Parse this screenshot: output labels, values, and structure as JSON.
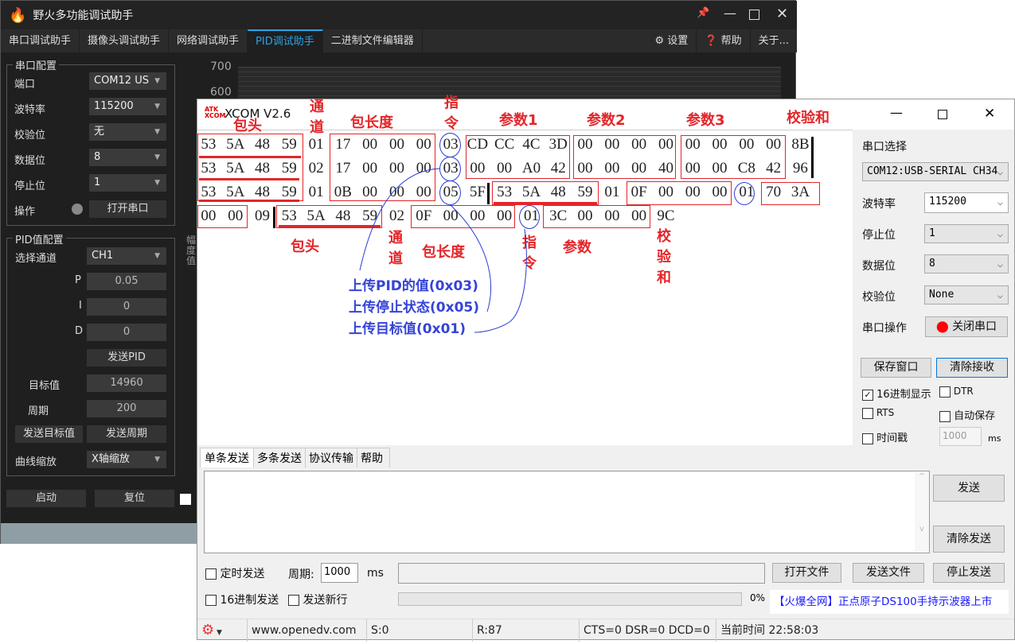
{
  "fire": {
    "title": "野火多功能调试助手",
    "tabs": [
      "串口调试助手",
      "摄像头调试助手",
      "网络调试助手",
      "PID调试助手",
      "二进制文件编辑器"
    ],
    "active_tab": "PID调试助手",
    "right_menu": {
      "settings": "设置",
      "help": "帮助",
      "about": "关于..."
    },
    "serial_group": "串口配置",
    "serial": [
      {
        "label": "端口",
        "value": "COM12 US"
      },
      {
        "label": "波特率",
        "value": "115200"
      },
      {
        "label": "校验位",
        "value": "无"
      },
      {
        "label": "数据位",
        "value": "8"
      },
      {
        "label": "停止位",
        "value": "1"
      }
    ],
    "op_label": "操作",
    "open_port": "打开串口",
    "pid_group": "PID值配置",
    "channel_label": "选择通道",
    "channel": "CH1",
    "p_label": "P",
    "p": "0.05",
    "i_label": "I",
    "i": "0",
    "d_label": "D",
    "d": "0",
    "send_pid": "发送PID",
    "target_label": "目标值",
    "target": "14960",
    "period_label": "周期",
    "period": "200",
    "send_target": "发送目标值",
    "send_period": "发送周期",
    "zoom_label": "曲线缩放",
    "zoom": "X轴缩放",
    "start": "启动",
    "reset": "复位",
    "chart_y": [
      "700",
      "600"
    ],
    "axis_label": "幅度值",
    "accent": "#2aa3e6"
  },
  "xcom": {
    "title": "XCOM V2.6",
    "logo": "ATK XCOM",
    "hex_rows": [
      [
        "53",
        "5A",
        "48",
        "59",
        "01",
        "17",
        "00",
        "00",
        "00",
        "03",
        "CD",
        "CC",
        "4C",
        "3D",
        "00",
        "00",
        "00",
        "00",
        "00",
        "00",
        "00",
        "00",
        "8B"
      ],
      [
        "53",
        "5A",
        "48",
        "59",
        "02",
        "17",
        "00",
        "00",
        "00",
        "03",
        "00",
        "00",
        "A0",
        "42",
        "00",
        "00",
        "00",
        "40",
        "00",
        "00",
        "C8",
        "42",
        "96"
      ],
      [
        "53",
        "5A",
        "48",
        "59",
        "01",
        "0B",
        "00",
        "00",
        "00",
        "05",
        "5F",
        "53",
        "5A",
        "48",
        "59",
        "01",
        "0F",
        "00",
        "00",
        "00",
        "01",
        "70",
        "3A"
      ],
      [
        "00",
        "00",
        "09",
        "53",
        "5A",
        "48",
        "59",
        "02",
        "0F",
        "00",
        "00",
        "00",
        "01",
        "3C",
        "00",
        "00",
        "00",
        "9C"
      ]
    ],
    "annot": {
      "head": "包头",
      "channel": "通道",
      "length": "包长度",
      "cmd": "指令",
      "p1": "参数1",
      "p2": "参数2",
      "p3": "参数3",
      "checksum": "校验和",
      "param": "参数"
    },
    "notes": [
      "上传PID的值(0x03)",
      "上传停止状态(0x05)",
      "上传目标值(0x01)"
    ],
    "panel": {
      "port_select": "串口选择",
      "port": "COM12:USB-SERIAL CH34",
      "baud_label": "波特率",
      "baud": "115200",
      "stop_label": "停止位",
      "stop": "1",
      "data_label": "数据位",
      "data": "8",
      "parity_label": "校验位",
      "parity": "None",
      "op_label": "串口操作",
      "close_port": "关闭串口",
      "save_window": "保存窗口",
      "clear_recv": "清除接收",
      "hex_display": "16进制显示",
      "dtr": "DTR",
      "rts": "RTS",
      "auto_save": "自动保存",
      "timestamp": "时间戳",
      "ts_value": "1000",
      "ms": "ms"
    },
    "send_tabs": [
      "单条发送",
      "多条发送",
      "协议传输",
      "帮助"
    ],
    "send": "发送",
    "clear_send": "清除发送",
    "timed_send": "定时发送",
    "period_label": "周期:",
    "period": "1000",
    "ms": "ms",
    "open_file": "打开文件",
    "send_file": "发送文件",
    "stop_send": "停止发送",
    "hex_send": "16进制发送",
    "newline": "发送新行",
    "progress": "0%",
    "ad": "【火爆全网】正点原子DS100手持示波器上市",
    "status": {
      "url": "www.openedv.com",
      "s": "S:0",
      "r": "R:87",
      "lines": "CTS=0 DSR=0 DCD=0",
      "time": "当前时间 22:58:03"
    }
  }
}
